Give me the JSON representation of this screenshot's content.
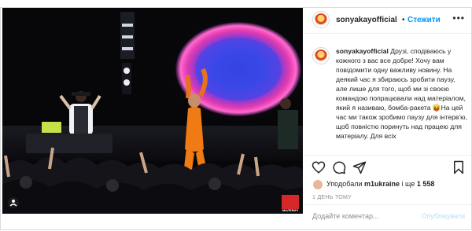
{
  "header": {
    "username": "sonyakayofficial",
    "separator": "•",
    "follow_label": "Стежити",
    "more_label": "•••"
  },
  "caption": {
    "username": "sonyakayofficial",
    "text": "Друзі, сподіваюсь у кожного з вас все добре! Хочу вам повідомити одну важливу новину. На деякий час я збираюсь зробити паузу, але лише для того, щоб ми зі своєю командою попрацювали над матеріалом, який я називаю, бомба-ракета 😝На цей час ми також зробимо паузу для інтерв'ю, щоб повністю поринуть над працею для матеріалу. Для всіх"
  },
  "media": {
    "watermark": "МАЛЕВИЧ"
  },
  "likes": {
    "prefix": "Уподобали",
    "user": "m1ukraine",
    "suffix": "і ще",
    "count": "1 558"
  },
  "time": "1 ДЕНЬ ТОМУ",
  "comment": {
    "placeholder": "Додайте коментар...",
    "post_label": "Опублікувати"
  },
  "colors": {
    "accent": "#0095f6",
    "text": "#262626",
    "muted": "#8e8e8e",
    "border": "#dbdbdb"
  },
  "icons": [
    "heart-icon",
    "comment-icon",
    "share-icon",
    "bookmark-icon",
    "more-icon",
    "person-tag-icon"
  ]
}
